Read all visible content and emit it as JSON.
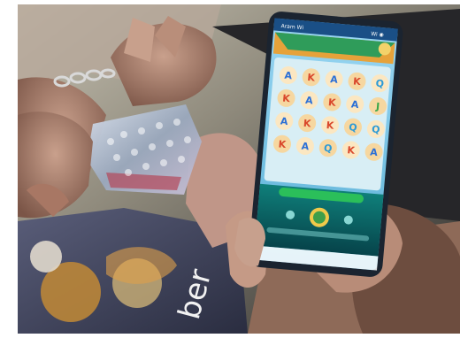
{
  "scene": {
    "status_bar": {
      "time": "Aram Wi",
      "indicators": "Wi ◉"
    },
    "game_reels": [
      [
        "A",
        "K",
        "A",
        "K",
        "Q"
      ],
      [
        "K",
        "A",
        "K",
        "A",
        "J"
      ],
      [
        "A",
        "K",
        "K",
        "Q",
        "Q"
      ],
      [
        "K",
        "A",
        "Q",
        "K",
        "A"
      ]
    ],
    "background_text": "ber",
    "colors": {
      "phone_frame": "#1b2430",
      "game_sky": "#87c7ea",
      "reel_panel": "#d8eef5",
      "game_footer": "#0d6a68",
      "bubble_wrap": "#b9c7d9",
      "shirt": "#4a4e68"
    }
  }
}
